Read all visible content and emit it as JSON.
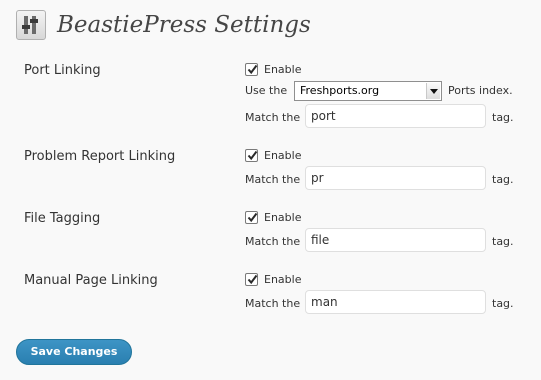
{
  "header": {
    "title": "BeastiePress Settings",
    "icon": "settings-sliders-icon"
  },
  "sections": {
    "port_linking": {
      "label": "Port Linking",
      "enable_label": "Enable",
      "enabled": true,
      "use_the_text": "Use the",
      "source_selected": "Freshports.org",
      "ports_index_text": "Ports index.",
      "match_the_text": "Match the",
      "match_tag": "port",
      "tag_text": "tag."
    },
    "problem_report_linking": {
      "label": "Problem Report Linking",
      "enable_label": "Enable",
      "enabled": true,
      "match_the_text": "Match the",
      "match_tag": "pr",
      "tag_text": "tag."
    },
    "file_tagging": {
      "label": "File Tagging",
      "enable_label": "Enable",
      "enabled": true,
      "match_the_text": "Match the",
      "match_tag": "file",
      "tag_text": "tag."
    },
    "manual_page_linking": {
      "label": "Manual Page Linking",
      "enable_label": "Enable",
      "enabled": true,
      "match_the_text": "Match the",
      "match_tag": "man",
      "tag_text": "tag."
    }
  },
  "save_button": {
    "label": "Save Changes"
  },
  "colors": {
    "accent": "#21759b",
    "button_bg": "#3d94c5",
    "background": "#f9f9f9"
  }
}
